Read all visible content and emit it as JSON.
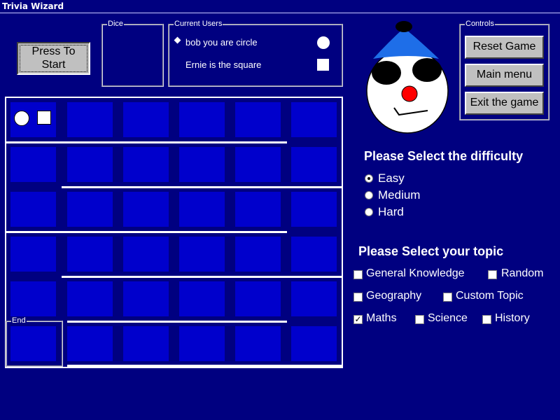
{
  "window": {
    "title": "Trivia Wizard"
  },
  "start_button": {
    "label_line1": "Press To",
    "label_line2": "Start"
  },
  "dice": {
    "legend": "Dice"
  },
  "current_users": {
    "legend": "Current Users",
    "users": [
      {
        "text": "bob you are circle",
        "token": "circle",
        "selected": true
      },
      {
        "text": "Ernie is the square",
        "token": "square",
        "selected": false
      }
    ]
  },
  "controls": {
    "legend": "Controls",
    "reset_label": "Reset Game",
    "main_menu_label": "Main menu",
    "exit_label": "Exit the game"
  },
  "mascot": {
    "icon": "wizard-face-icon",
    "colors": {
      "hat": "#1e6ee8",
      "nose": "#ff0000",
      "face": "#ffffff"
    }
  },
  "board": {
    "end_legend": "End",
    "rows": 6,
    "cols": 6,
    "cell_color": "#0000cc"
  },
  "difficulty": {
    "heading": "Please Select the difficulty",
    "options": [
      {
        "label": "Easy",
        "checked": true
      },
      {
        "label": "Medium",
        "checked": false
      },
      {
        "label": "Hard",
        "checked": false
      }
    ]
  },
  "topic": {
    "heading": "Please Select your topic",
    "options": {
      "general_knowledge": {
        "label": "General Knowledge",
        "checked": false
      },
      "random": {
        "label": "Random",
        "checked": false
      },
      "geography": {
        "label": "Geography",
        "checked": false
      },
      "custom_topic": {
        "label": "Custom Topic",
        "checked": false
      },
      "maths": {
        "label": "Maths",
        "checked": true
      },
      "science": {
        "label": "Science",
        "checked": false
      },
      "history": {
        "label": "History",
        "checked": false
      }
    }
  },
  "colors": {
    "background": "#000080",
    "accent": "#0000cc",
    "button_face": "#c0c0c0"
  }
}
